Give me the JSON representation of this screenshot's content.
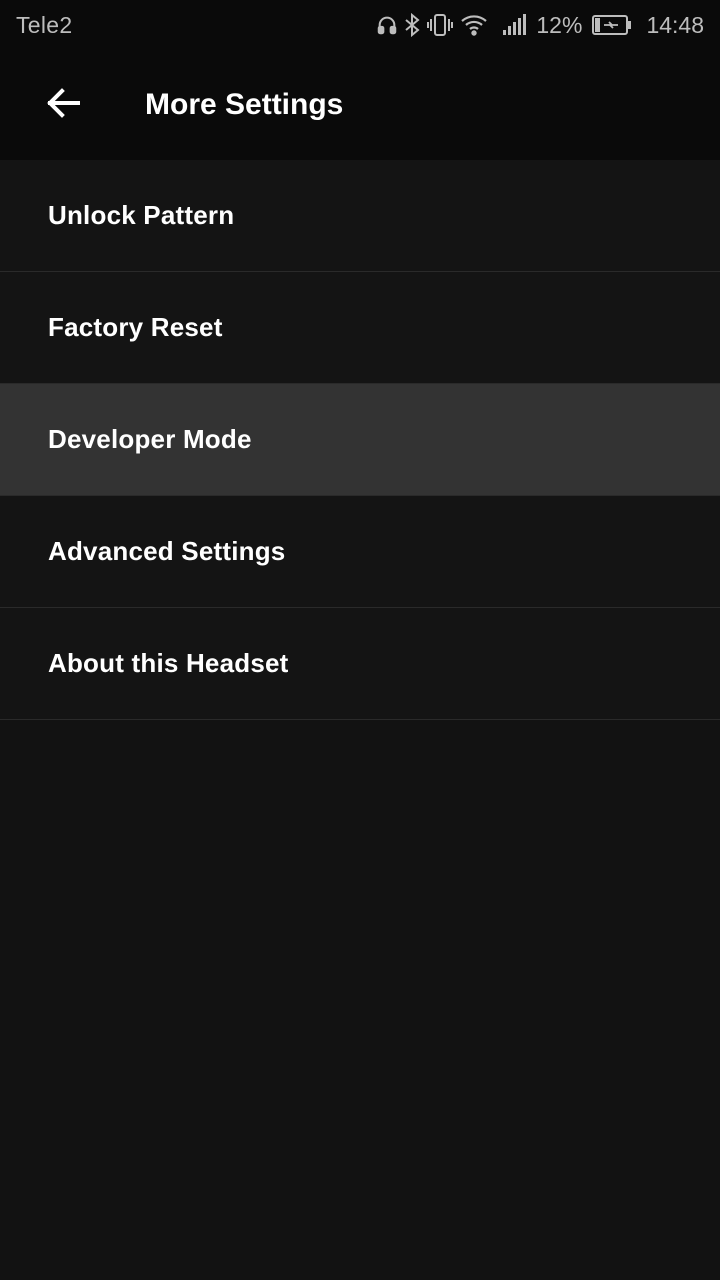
{
  "status_bar": {
    "carrier": "Tele2",
    "battery_percent": "12%",
    "time": "14:48",
    "icons": [
      "headset-icon",
      "bluetooth-icon",
      "vibrate-icon",
      "wifi-icon",
      "signal-icon",
      "battery-charging-icon"
    ]
  },
  "toolbar": {
    "back_icon": "arrow-left-icon",
    "title": "More Settings"
  },
  "menu": {
    "items": [
      {
        "label": "Unlock Pattern"
      },
      {
        "label": "Factory Reset"
      },
      {
        "label": "Developer Mode",
        "state": "pressed"
      },
      {
        "label": "Advanced Settings"
      },
      {
        "label": "About this Headset"
      }
    ]
  },
  "colors": {
    "background": "#121212",
    "bar_background": "#0a0a0a",
    "item_background": "#141414",
    "pressed_background": "#333333",
    "divider": "#2a2a2a",
    "text": "#ffffff",
    "status_text": "#bdbdbd"
  }
}
